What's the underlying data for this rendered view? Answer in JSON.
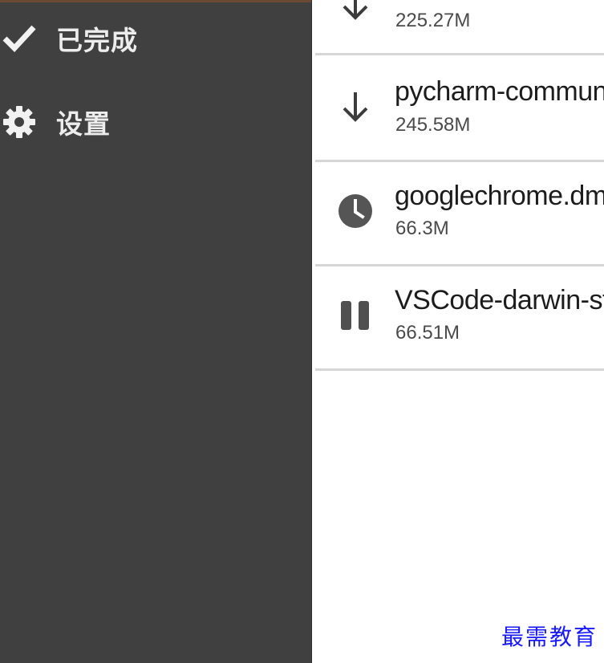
{
  "sidebar": {
    "items": [
      {
        "label": "已完成",
        "icon": "checkmark-icon"
      },
      {
        "label": "设置",
        "icon": "gear-icon"
      }
    ]
  },
  "downloads": [
    {
      "name": "",
      "size": "225.27M",
      "status_icon": "download-arrow-icon"
    },
    {
      "name": "pycharm-community",
      "size": "245.58M",
      "status_icon": "download-arrow-icon"
    },
    {
      "name": "googlechrome.dmg",
      "size": "66.3M",
      "status_icon": "clock-icon"
    },
    {
      "name": "VSCode-darwin-stable",
      "size": "66.51M",
      "status_icon": "pause-icon"
    }
  ],
  "watermark": "最需教育",
  "colors": {
    "sidebar_bg": "#404040",
    "sidebar_text": "#ededed",
    "divider": "#d6d6d6",
    "icon": "#3c3c3c",
    "watermark": "#1a1aff"
  }
}
